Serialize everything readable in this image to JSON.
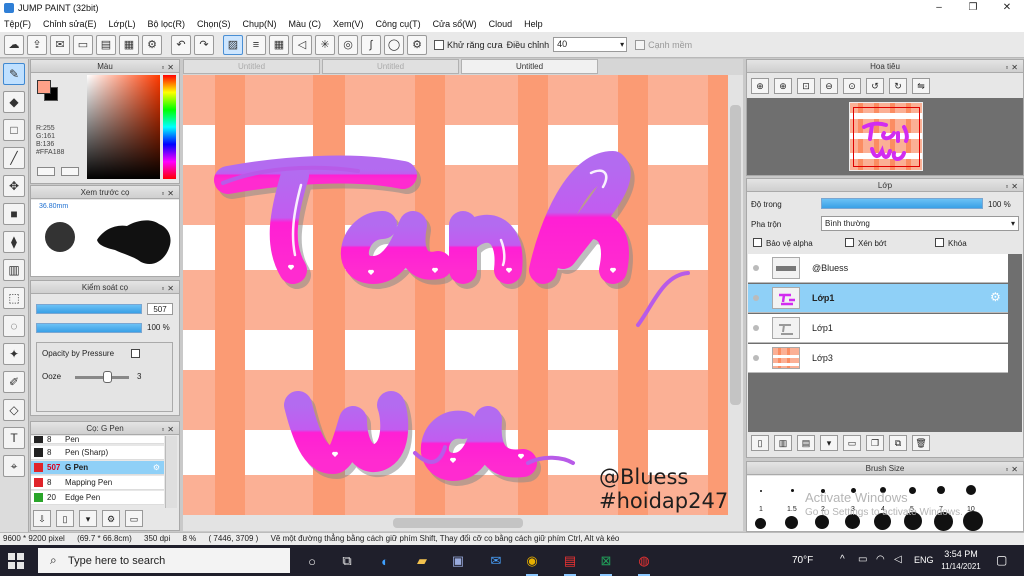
{
  "window": {
    "title": "JUMP PAINT (32bit)",
    "controls": [
      "–",
      "❐",
      "✕"
    ]
  },
  "menu": [
    "Tệp(F)",
    "Chỉnh sửa(E)",
    "Lớp(L)",
    "Bộ lọc(R)",
    "Chọn(S)",
    "Chụp(N)",
    "Màu (C)",
    "Xem(V)",
    "Công cụ(T)",
    "Cửa sổ(W)",
    "Cloud",
    "Help"
  ],
  "toolbar": {
    "antialias_label": "Khử răng cưa",
    "adjust_label": "Điều chỉnh",
    "adjust_value": "40",
    "snap_label": "Cạnh mềm"
  },
  "color_panel": {
    "title": "Màu",
    "main_color": "#FFA188",
    "rgb_lines": [
      "R:255",
      "G:161",
      "B:136",
      "#FFA188"
    ]
  },
  "brush_preview": {
    "title": "Xem trước cọ",
    "size": "36.80mm"
  },
  "control": {
    "title": "Kiểm soát cọ",
    "size_value": "507",
    "opacity_value": "100 %",
    "opacity_by_pressure_label": "Opacity by Pressure",
    "ooze_label": "Ooze",
    "ooze_value": "3"
  },
  "brushes": {
    "title": "Cọ: G Pen",
    "items": [
      {
        "size": "8",
        "name": "Pen",
        "color": "#222222"
      },
      {
        "size": "8",
        "name": "Pen (Sharp)",
        "color": "#222222"
      },
      {
        "size": "507",
        "name": "G Pen",
        "color": "#e0242a",
        "selected": true
      },
      {
        "size": "8",
        "name": "Mapping Pen",
        "color": "#e0242a"
      },
      {
        "size": "20",
        "name": "Edge Pen",
        "color": "#2aa52a"
      }
    ]
  },
  "tabs": [
    "Untitled",
    "Untitled",
    "Untitled"
  ],
  "canvas": {
    "lettering_top": "Tanh",
    "lettering_bottom": "wa",
    "watermark_line1": "@Bluess",
    "watermark_line2": "#hoidap247"
  },
  "navigator": {
    "title": "Hoa tiêu"
  },
  "layers": {
    "title": "Lớp",
    "opacity_label": "Độ trong",
    "opacity_value": "100 %",
    "blend_label": "Pha trộn",
    "blend_value": "Bình thường",
    "protect_alpha_label": "Bảo vệ alpha",
    "clipping_label": "Xén bớt",
    "lock_label": "Khóa",
    "items": [
      {
        "name": "@Bluess",
        "selected": false
      },
      {
        "name": "Lớp1",
        "selected": true
      },
      {
        "name": "Lớp1",
        "selected": false
      },
      {
        "name": "Lớp3",
        "selected": false
      }
    ]
  },
  "brush_size": {
    "title": "Brush Size",
    "labels": [
      "1",
      "1.5",
      "2",
      "3",
      "4",
      "5",
      "7",
      "10"
    ],
    "activate_title": "Activate Windows",
    "activate_sub": "Go to Settings to activate Windows."
  },
  "status": {
    "dimensions": "9600 * 9200 pixel",
    "physical": "(69.7 * 66.8cm)",
    "dpi": "350 dpi",
    "zoom": "8 %",
    "coords": "( 7446, 3709 )",
    "hint": "Vẽ một đường thẳng bằng cách giữ phím Shift, Thay đổi cỡ cọ bằng cách giữ phím Ctrl, Alt và kéo"
  },
  "taskbar": {
    "search_placeholder": "Type here to search",
    "weather": "70°F",
    "language": "ENG",
    "time": "3:54 PM",
    "date": "11/14/2021"
  }
}
